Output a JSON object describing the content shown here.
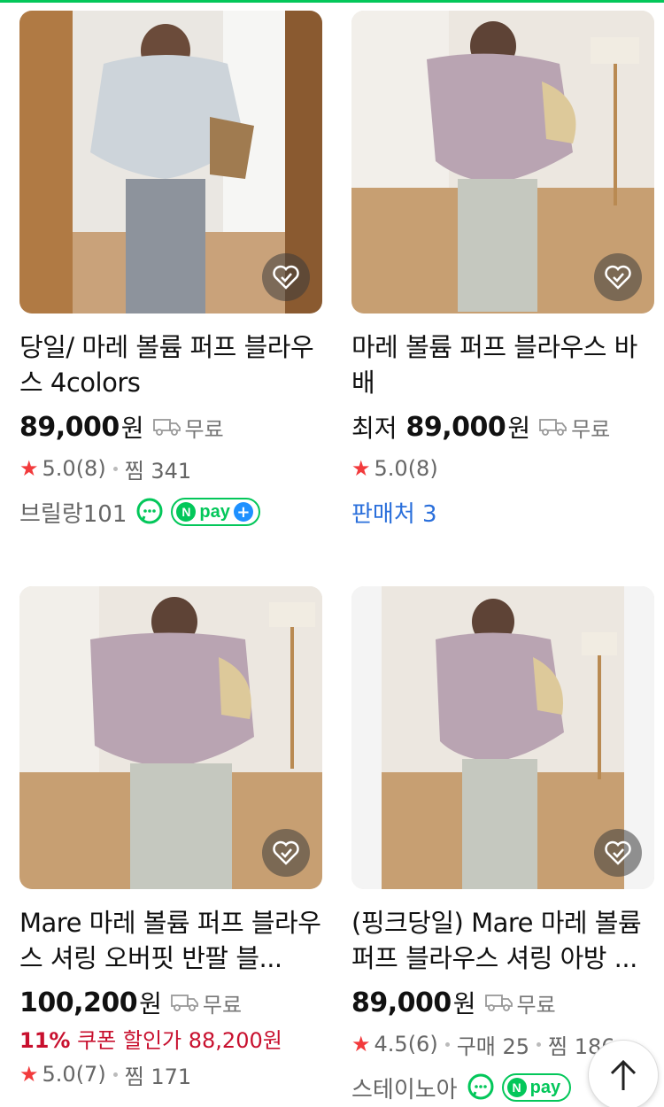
{
  "theme": {
    "accent": "#03c75a",
    "coupon_color": "#c8102e",
    "star_color": "#f23a3c",
    "link_color": "#2a6fdb"
  },
  "products": [
    {
      "title": "당일/ 마레 볼륨 퍼프 블라우스 4colors",
      "price_prefix": "",
      "price": "89,000",
      "currency": "원",
      "shipping": "무료",
      "rating": "5.0",
      "review_count": "(8)",
      "extra_stats": [
        "찜 341"
      ],
      "seller": "브릴랑101",
      "talk_icon": "naver-talk-icon",
      "npay": "pay",
      "coupon": ""
    },
    {
      "title": "마레 볼륨 퍼프 블라우스 바배",
      "price_prefix": "최저",
      "price": "89,000",
      "currency": "원",
      "shipping": "무료",
      "rating": "5.0",
      "review_count": "(8)",
      "extra_stats": [],
      "sellers_link": "판매처 3",
      "coupon": ""
    },
    {
      "title": "Mare 마레 볼륨 퍼프 블라우스 셔링 오버핏 반팔 블...",
      "price_prefix": "",
      "price": "100,200",
      "currency": "원",
      "shipping": "무료",
      "coupon_rate": "11%",
      "coupon_text": "쿠폰 할인가 88,200원",
      "rating": "5.0",
      "review_count": "(7)",
      "extra_stats": [
        "찜 171"
      ]
    },
    {
      "title": "(핑크당일) Mare 마레 볼륨 퍼프 블라우스 셔링 아방 ...",
      "price_prefix": "",
      "price": "89,000",
      "currency": "원",
      "shipping": "무료",
      "rating": "4.5",
      "review_count": "(6)",
      "extra_stats": [
        "구매 25",
        "찜 186"
      ],
      "seller": "스테이노아",
      "npay": "pay"
    }
  ],
  "scroll_top_icon": "arrow-up-icon"
}
